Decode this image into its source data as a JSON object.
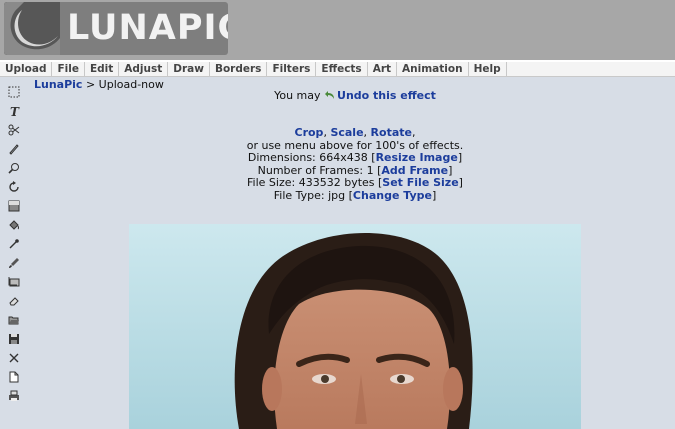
{
  "logo": {
    "text": "LUNAPIC"
  },
  "menu": [
    "Upload",
    "File",
    "Edit",
    "Adjust",
    "Draw",
    "Borders",
    "Filters",
    "Effects",
    "Art",
    "Animation",
    "Help"
  ],
  "breadcrumb": {
    "home": "LunaPic",
    "separator": " > ",
    "current": "Upload-now"
  },
  "undo": {
    "prefix": "You may ",
    "link": "Undo this effect"
  },
  "info": {
    "crop": "Crop",
    "scale": "Scale",
    "rotate": "Rotate",
    "sep1": ", ",
    "sep2": ", ",
    "trail": ",",
    "menu_hint": "or use menu above for 100's of effects.",
    "dimensions_label": "Dimensions: 664x438 [",
    "dimensions_link": "Resize Image",
    "frames_label": "Number of Frames: 1 [",
    "frames_link": "Add Frame",
    "filesize_label": "File Size: 433532 bytes [",
    "filesize_link": "Set File Size",
    "filetype_label": "File Type: jpg [",
    "filetype_link": "Change Type",
    "close": "]"
  },
  "tools": [
    "marquee-select-icon",
    "text-icon",
    "scissors-icon",
    "pencil-icon",
    "zoom-icon",
    "rotate-icon",
    "gradient-icon",
    "paint-bucket-icon",
    "eyedropper-icon",
    "brush-icon",
    "crop-icon",
    "eraser-icon",
    "open-folder-icon",
    "save-icon",
    "close-icon",
    "new-document-icon",
    "print-icon"
  ],
  "colors": {
    "link": "#1c3d9c",
    "header": "#a7a7a7",
    "page_bg": "#d7dde6"
  }
}
